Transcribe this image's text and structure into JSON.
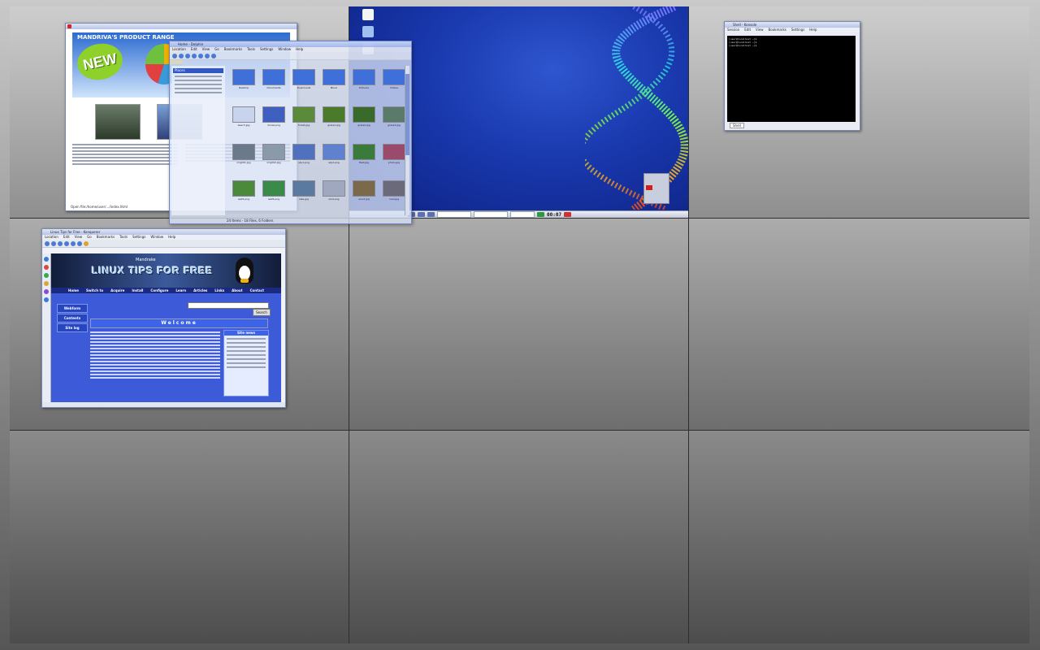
{
  "desktops": [
    "1",
    "2",
    "3",
    "4",
    "5",
    "6",
    "7",
    "8",
    "9"
  ],
  "active_desktop": "2",
  "panel": {
    "clock": "00:07"
  },
  "windows": {
    "mandriva": {
      "title": "MANDRIVA'S PRODUCT RANGE",
      "badge": "NEW",
      "status": "Open file:/home/user/.../index.html"
    },
    "terminal": {
      "title": "Shell - Konsole",
      "menu": [
        "Session",
        "Edit",
        "View",
        "Bookmarks",
        "Settings",
        "Help"
      ],
      "lines": [
        "[user@localhost ~]$ ",
        "[user@localhost ~]$ ",
        "[user@localhost ~]$ "
      ],
      "tab": "Shell"
    },
    "konqueror": {
      "title": "Linux Tips for Free - Konqueror",
      "menu": [
        "Location",
        "Edit",
        "View",
        "Go",
        "Bookmarks",
        "Tools",
        "Settings",
        "Window",
        "Help"
      ],
      "site_brand": "Mandrake",
      "site_title": "LINUX TIPS FOR FREE",
      "nav": [
        "Home",
        "Switch to",
        "Acquire",
        "Install",
        "Configure",
        "Learn",
        "Articles",
        "Links",
        "About",
        "Contact"
      ],
      "left_menu": [
        "Webform",
        "Contents",
        "Site log"
      ],
      "welcome": "Welcome",
      "search_button": "Search",
      "news_title": "Site news"
    },
    "filemanager": {
      "title": "Home - Dolphin",
      "menu": [
        "Location",
        "Edit",
        "View",
        "Go",
        "Bookmarks",
        "Tools",
        "Settings",
        "Window",
        "Help"
      ],
      "sidebar_header": "Places",
      "items": [
        "Desktop",
        "Documents",
        "Downloads",
        "Music",
        "Pictures",
        "Videos",
        "beach.jpg",
        "dunes.png",
        "forest.jpg",
        "grass1.jpg",
        "grass2.jpg",
        "grass3.jpg",
        "img001.jpg",
        "img002.jpg",
        "sky1.png",
        "sky2.png",
        "field.jpg",
        "photo.jpg",
        "leaf1.png",
        "leaf2.png",
        "lake.jpg",
        "shot.png",
        "wood.jpg",
        "road.jpg"
      ],
      "status": "24 Items - 18 Files, 6 Folders"
    }
  }
}
